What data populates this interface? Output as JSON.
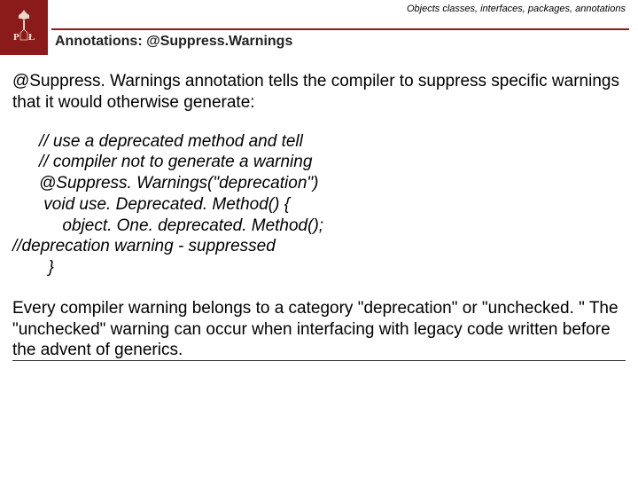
{
  "header": {
    "breadcrumb": "Objects classes, interfaces, packages, annotations",
    "title": "Annotations: @Suppress.Warnings",
    "logo_alt": "PL"
  },
  "body": {
    "intro": " @Suppress. Warnings annotation tells the compiler to suppress specific warnings that it would otherwise generate:",
    "code": {
      "l1": "// use a deprecated method and tell",
      "l2": "// compiler not to generate a warning",
      "l3": "@Suppress. Warnings(\"deprecation\")",
      "l4": " void use. Deprecated. Method() {",
      "l5": "     object. One. deprecated. Method();",
      "l6": "//deprecation warning - suppressed",
      "l7": "  }"
    },
    "outro": "Every compiler warning belongs to a category \"deprecation\" or \"unchecked. \" The \"unchecked\" warning can occur when interfacing with legacy code written before the advent of generics."
  }
}
